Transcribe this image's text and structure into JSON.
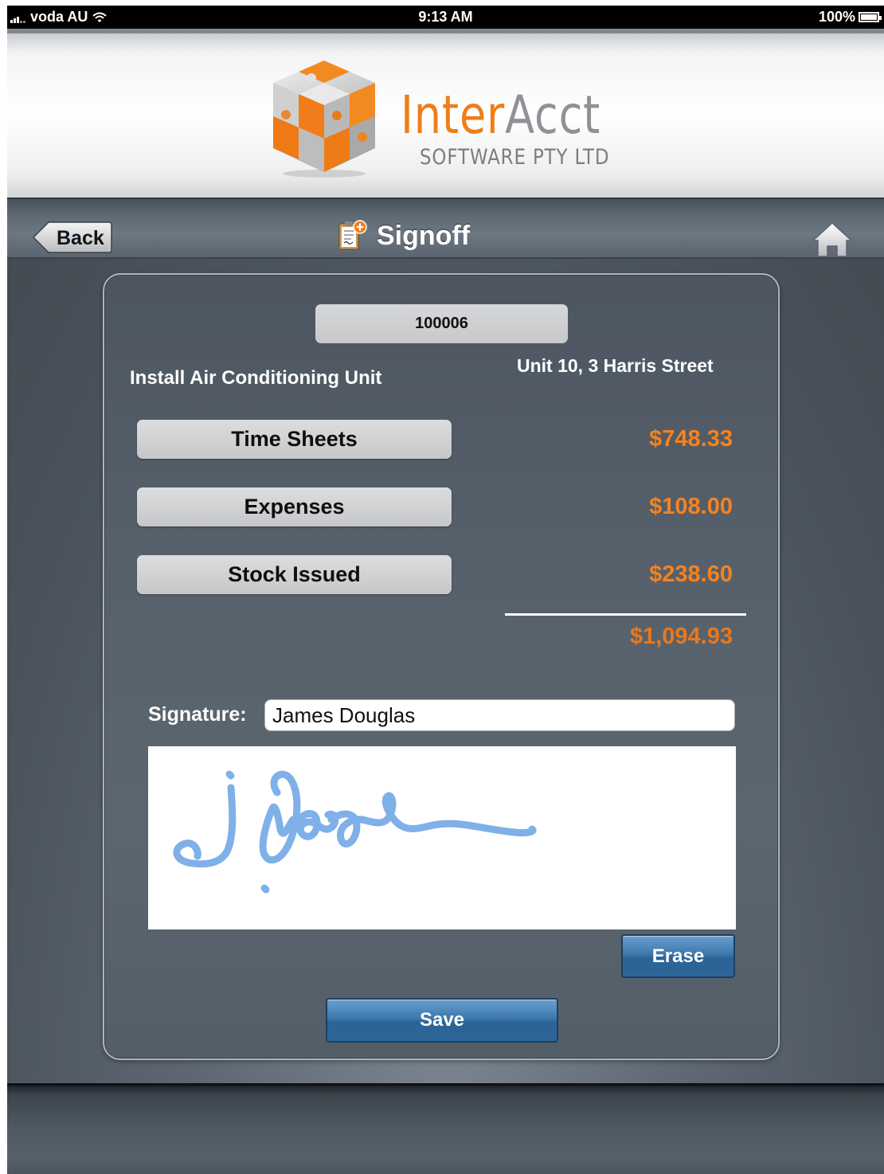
{
  "status_bar": {
    "carrier": "voda AU",
    "time": "9:13 AM",
    "battery": "100%"
  },
  "header": {
    "brand_part1": "Inter",
    "brand_part2": "Acct",
    "tagline": "SOFTWARE PTY LTD"
  },
  "navbar": {
    "back_label": "Back",
    "title": "Signoff"
  },
  "job": {
    "number": "100006",
    "description": "Install Air Conditioning Unit",
    "address": "Unit 10, 3 Harris Street"
  },
  "costs": [
    {
      "label": "Time Sheets",
      "amount": "$748.33"
    },
    {
      "label": "Expenses",
      "amount": "$108.00"
    },
    {
      "label": "Stock Issued",
      "amount": "$238.60"
    }
  ],
  "total": "$1,094.93",
  "signature": {
    "label": "Signature:",
    "name": "James Douglas"
  },
  "buttons": {
    "erase": "Erase",
    "save": "Save"
  },
  "colors": {
    "amount": "#f6821d",
    "signature_ink": "#7fb0e8",
    "button_blue": "#3d78ac"
  }
}
